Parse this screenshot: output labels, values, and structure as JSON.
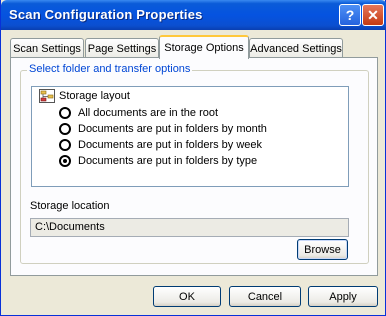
{
  "window": {
    "title": "Scan Configuration Properties",
    "help_label": "?",
    "close_label": "✕"
  },
  "tabs": [
    {
      "label": "Scan Settings",
      "active": false
    },
    {
      "label": "Page Settings",
      "active": false
    },
    {
      "label": "Storage Options",
      "active": true
    },
    {
      "label": "Advanced Settings",
      "active": false
    }
  ],
  "group": {
    "legend": "Select folder and transfer options",
    "layout_title": "Storage layout",
    "options": [
      {
        "label": "All documents are in the root",
        "selected": false
      },
      {
        "label": "Documents are put in folders by month",
        "selected": false
      },
      {
        "label": "Documents are put in folders by week",
        "selected": false
      },
      {
        "label": "Documents are put in folders by type",
        "selected": true
      }
    ],
    "location_label": "Storage location",
    "location_value": "C:\\Documents",
    "browse_label": "Browse"
  },
  "buttons": {
    "ok": "OK",
    "cancel": "Cancel",
    "apply": "Apply"
  },
  "icons": {
    "help": "help-icon",
    "close": "close-icon",
    "layout": "folder-tree-icon"
  }
}
